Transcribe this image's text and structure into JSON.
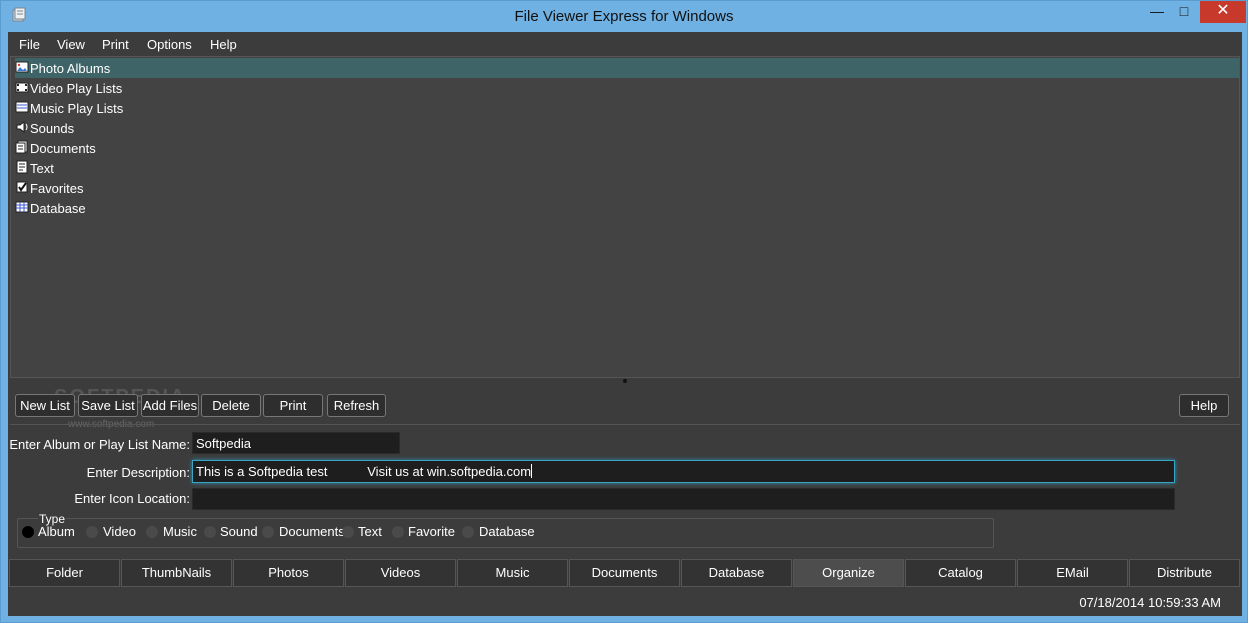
{
  "window": {
    "title": "File Viewer Express for Windows",
    "close_glyph": "✕",
    "max_glyph": "□",
    "min_glyph": "—"
  },
  "menu": [
    "File",
    "View",
    "Print",
    "Options",
    "Help"
  ],
  "tree": {
    "items": [
      {
        "label": "Photo Albums",
        "icon": "photo-album-icon",
        "selected": true
      },
      {
        "label": "Video Play Lists",
        "icon": "video-list-icon",
        "selected": false
      },
      {
        "label": "Music Play Lists",
        "icon": "music-list-icon",
        "selected": false
      },
      {
        "label": "Sounds",
        "icon": "sound-icon",
        "selected": false
      },
      {
        "label": "Documents",
        "icon": "document-icon",
        "selected": false
      },
      {
        "label": "Text",
        "icon": "text-icon",
        "selected": false
      },
      {
        "label": "Favorites",
        "icon": "favorites-icon",
        "selected": false
      },
      {
        "label": "Database",
        "icon": "database-icon",
        "selected": false
      }
    ]
  },
  "toolbar": {
    "new_list": "New List",
    "save_list": "Save List",
    "add_files": "Add Files",
    "delete": "Delete",
    "print": "Print",
    "refresh": "Refresh",
    "help": "Help"
  },
  "watermark": {
    "text": "SOFTPEDIA",
    "url": "www.softpedia.com"
  },
  "form": {
    "name_label": "Enter Album or Play List Name:",
    "name_value": "Softpedia",
    "desc_label": "Enter Description:",
    "desc_value": "This is a Softpedia test           Visit us at win.softpedia.com",
    "icon_label": "Enter Icon Location:",
    "icon_value": ""
  },
  "type_group": {
    "legend": "Type",
    "options": [
      "Album",
      "Video",
      "Music",
      "Sound",
      "Documents",
      "Text",
      "Favorite",
      "Database"
    ],
    "selected": "Album"
  },
  "tabs": [
    "Folder",
    "ThumbNails",
    "Photos",
    "Videos",
    "Music",
    "Documents",
    "Database",
    "Organize",
    "Catalog",
    "EMail",
    "Distribute"
  ],
  "active_tab": "Organize",
  "status": {
    "datetime": "07/18/2014 10:59:33 AM"
  }
}
